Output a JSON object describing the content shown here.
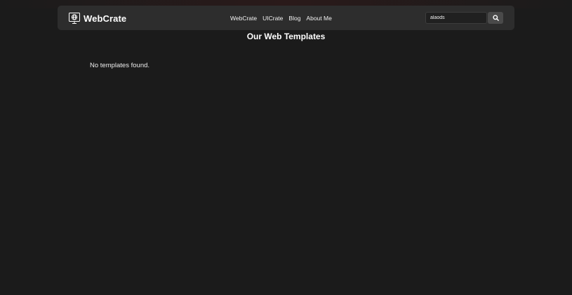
{
  "header": {
    "brand_name": "WebCrate",
    "nav": [
      {
        "label": "WebCrate"
      },
      {
        "label": "UICrate"
      },
      {
        "label": "Blog"
      },
      {
        "label": "About Me"
      }
    ],
    "search": {
      "value": "alaods",
      "button_icon": "search-icon"
    }
  },
  "main": {
    "title": "Our Web Templates",
    "empty_message": "No templates found."
  },
  "colors": {
    "background": "#1b1b1b",
    "navbar": "#2d2d2d",
    "search_button": "#4a4a4a",
    "text": "#ffffff"
  }
}
